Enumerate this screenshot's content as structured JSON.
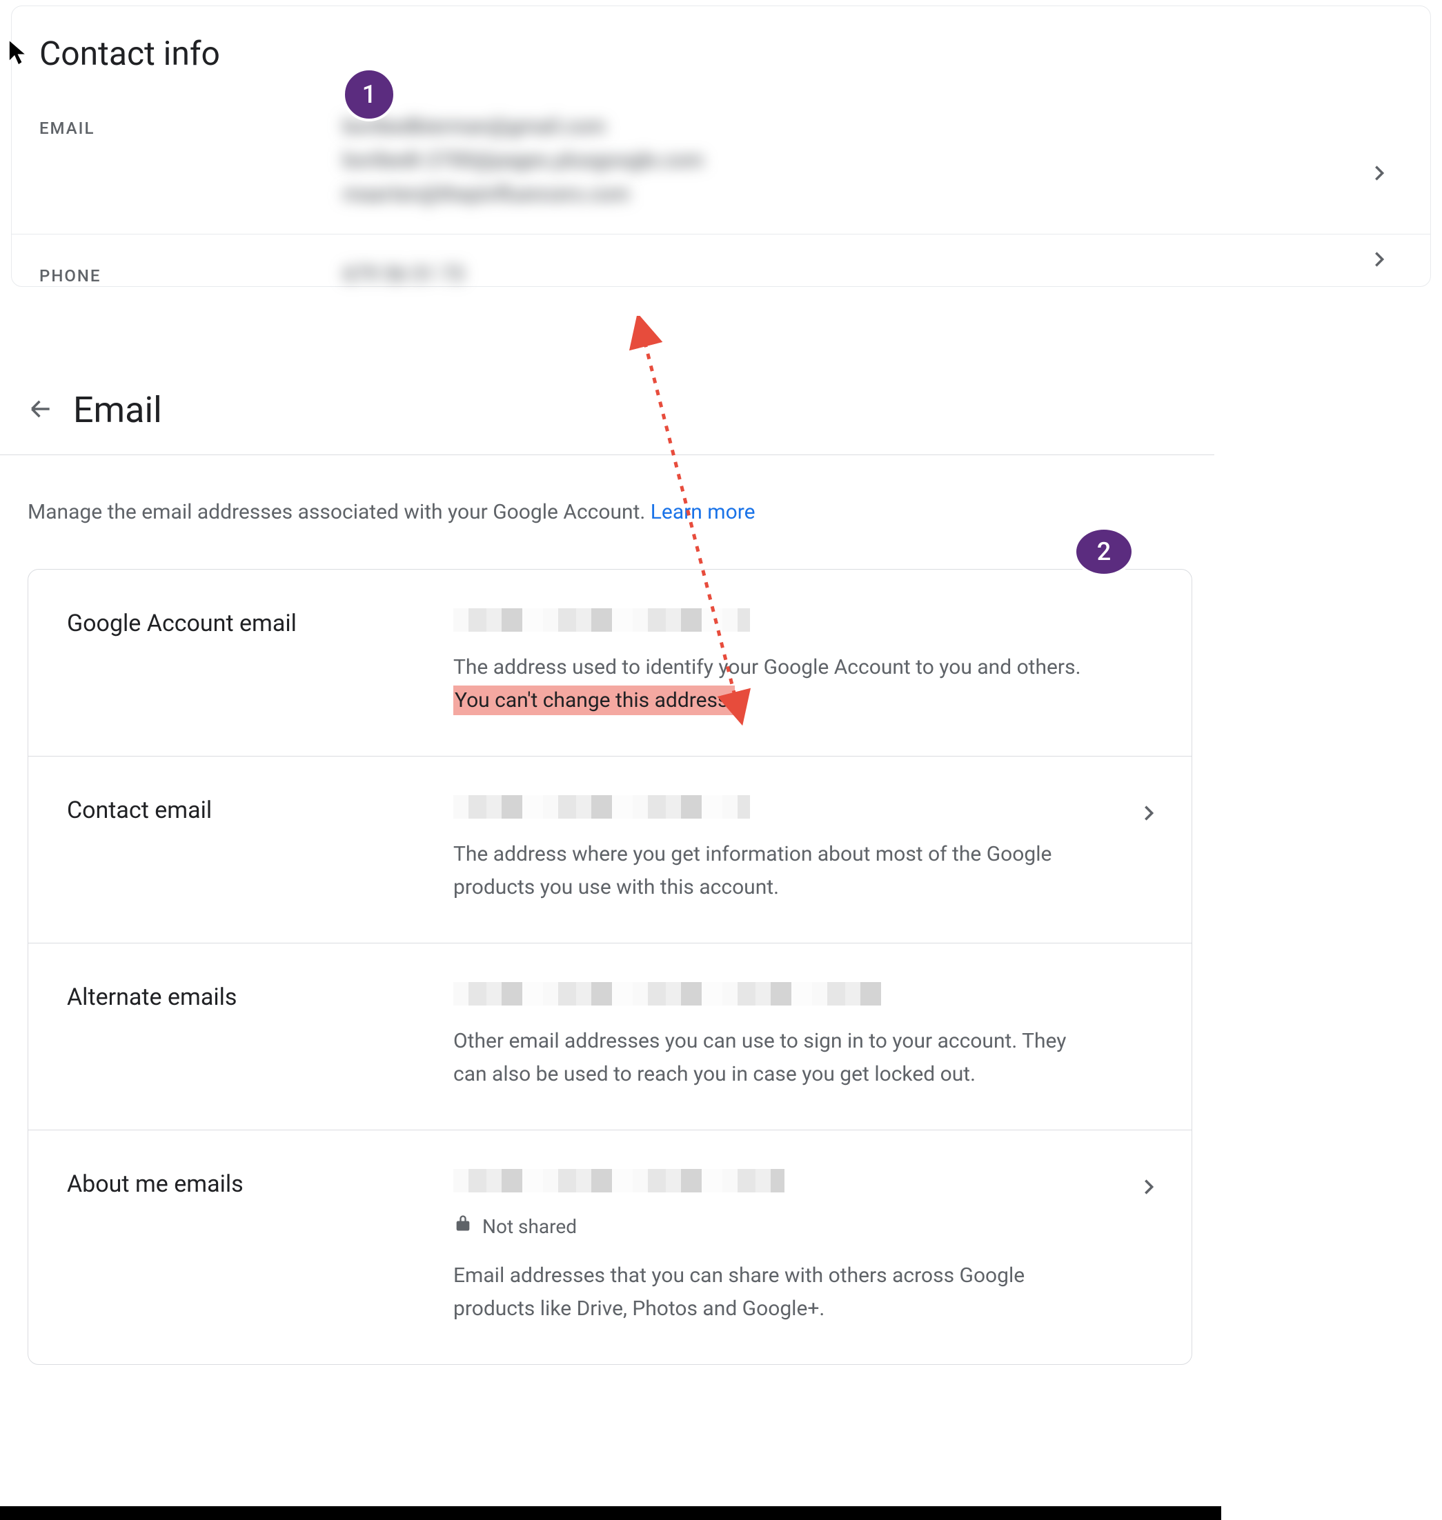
{
  "badges": {
    "one": "1",
    "two": "2"
  },
  "contact": {
    "title": "Contact info",
    "email_label": "EMAIL",
    "emails": [
      "boribedbierman@gmail.com",
      "boribedt-2700@pages.plusgoogle.com",
      "maarten@thepinfluencers.com"
    ],
    "phone_label": "PHONE",
    "phone": "679 56 51 73"
  },
  "email_page": {
    "title": "Email",
    "intro_a": "Manage the email addresses associated with your Google Account. ",
    "learn_more": "Learn more",
    "items": [
      {
        "id": "google-account-email",
        "label": "Google Account email",
        "desc_a": "The address used to identify your Google Account to you and others. ",
        "desc_hl": "You can't change this address.",
        "chevron": false
      },
      {
        "id": "contact-email",
        "label": "Contact email",
        "desc": "The address where you get information about most of the Google products you use with this account.",
        "chevron": true
      },
      {
        "id": "alternate-emails",
        "label": "Alternate emails",
        "desc": "Other email addresses you can use to sign in to your account. They can also be used to reach you in case you get locked out.",
        "chevron": false
      },
      {
        "id": "about-me-emails",
        "label": "About me emails",
        "not_shared": "Not shared",
        "desc": "Email addresses that you can share with others across Google products like Drive, Photos and Google+.",
        "chevron": true
      }
    ]
  }
}
